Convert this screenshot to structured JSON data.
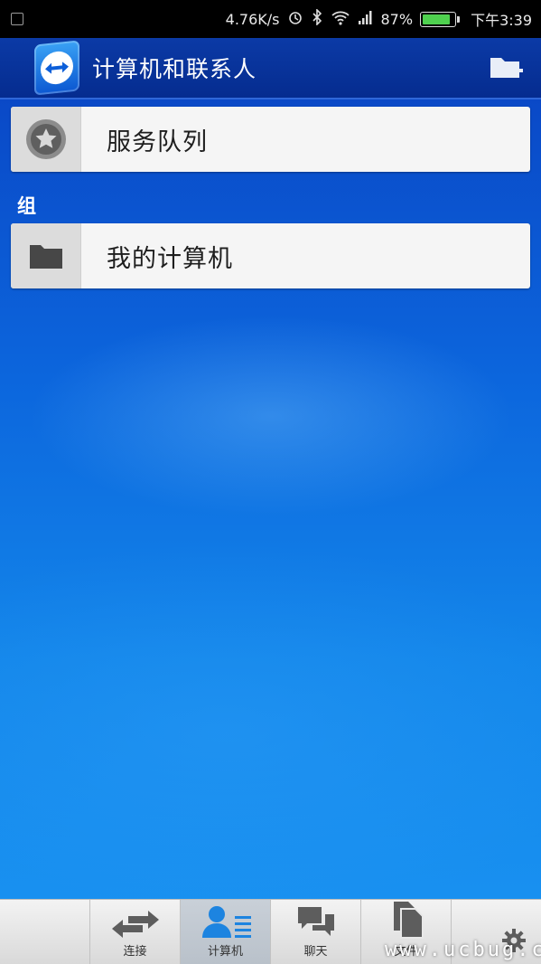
{
  "status_bar": {
    "speed": "4.76K/s",
    "battery": "87%",
    "battery_level": 0.87,
    "time": "下午3:39",
    "icons": [
      "notification-icon",
      "alarm-icon",
      "bluetooth-icon",
      "wifi-icon",
      "signal-icon",
      "battery-icon"
    ]
  },
  "app_bar": {
    "title": "计算机和联系人",
    "logo_icon": "teamviewer-logo",
    "action_icon": "add-group-icon"
  },
  "list": {
    "service_queue_label": "服务队列",
    "service_queue_icon": "star-icon",
    "section_header": "组",
    "group_label": "我的计算机",
    "group_icon": "folder-icon"
  },
  "bottom_nav": {
    "items": [
      {
        "label": "",
        "icon": ""
      },
      {
        "label": "连接",
        "icon": "connect-arrows-icon"
      },
      {
        "label": "计算机",
        "icon": "computers-contacts-icon",
        "active": true
      },
      {
        "label": "聊天",
        "icon": "chat-icon"
      },
      {
        "label": "文件",
        "icon": "files-icon"
      },
      {
        "label": "",
        "icon": "settings-gear-icon"
      }
    ]
  },
  "watermark": "www.ucbug.cc",
  "colors": {
    "app_bar": "#0b3aa6",
    "background": "#0c66dd",
    "row": "#f5f5f5"
  }
}
